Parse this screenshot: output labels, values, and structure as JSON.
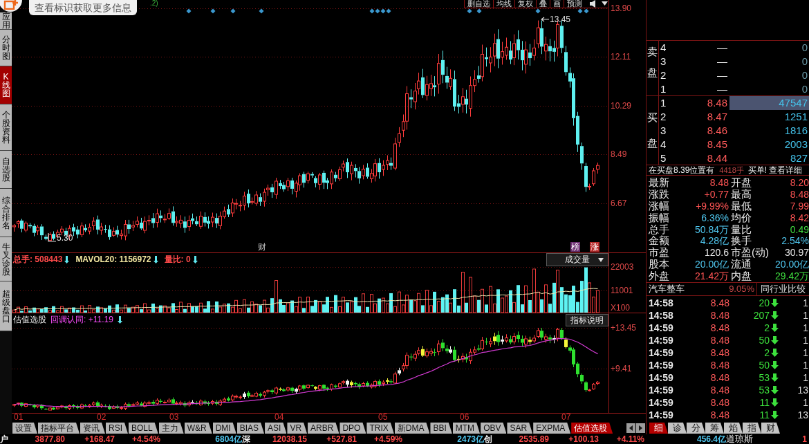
{
  "sidebar": {
    "tabs": [
      {
        "label": "应用",
        "selected": false
      },
      {
        "label": "分时图",
        "selected": false
      },
      {
        "label": "K线图",
        "selected": true
      },
      {
        "label": "个股资料",
        "selected": false
      },
      {
        "label": "自选股",
        "selected": false
      },
      {
        "label": "综合排名",
        "selected": false
      },
      {
        "label": "牛叉诊股",
        "selected": false
      },
      {
        "label": "超级盘口",
        "selected": false
      }
    ]
  },
  "tooltip": {
    "text": "查看标识获取更多信息"
  },
  "price_chart": {
    "title_fragment": ".2)",
    "toolbar": [
      "删自选",
      "均线",
      "复权",
      "叠",
      "画",
      "预测"
    ],
    "axis": [
      "13.90",
      "12.11",
      "10.29",
      "8.49",
      "6.67"
    ],
    "annotations": [
      {
        "kind": "high",
        "text": "13.45"
      },
      {
        "kind": "low",
        "text": "5.30"
      }
    ],
    "events": [
      {
        "text": "财",
        "kind": "plain"
      },
      {
        "text": "榜",
        "kind": "tag",
        "color": "#6e2f72"
      },
      {
        "text": "涨",
        "kind": "tag",
        "color": "#b82a2a"
      }
    ]
  },
  "volume_panel": {
    "stats": [
      {
        "text": "总手: 508443",
        "color": "#ff4a4a"
      },
      {
        "text": "MAVOL20: 1156972",
        "color": "#f2e6a0"
      },
      {
        "text": "量比: 0",
        "color": "#ff4a4a"
      }
    ],
    "selector": "成交量",
    "axis": [
      "22003",
      "11001",
      "X100"
    ]
  },
  "indicator_panel": {
    "name": "估值选股",
    "reading": "回调认同: +11.19",
    "help_button": "指标说明",
    "axis": [
      "+13.45",
      "+9.41"
    ]
  },
  "time_axis": [
    "01",
    "02",
    "03",
    "04",
    "05",
    "06",
    "07"
  ],
  "indicator_tabs": [
    {
      "label": "设置",
      "selected": false
    },
    {
      "label": "指标平台",
      "selected": false
    },
    {
      "label": "资讯",
      "selected": false
    },
    {
      "label": "RSI",
      "selected": false
    },
    {
      "label": "BOLL",
      "selected": false
    },
    {
      "label": "主力",
      "selected": false
    },
    {
      "label": "W&R",
      "selected": false
    },
    {
      "label": "DMI",
      "selected": false
    },
    {
      "label": "BIAS",
      "selected": false
    },
    {
      "label": "ASI",
      "selected": false
    },
    {
      "label": "VR",
      "selected": false
    },
    {
      "label": "ARBR",
      "selected": false
    },
    {
      "label": "DPO",
      "selected": false
    },
    {
      "label": "TRIX",
      "selected": false
    },
    {
      "label": "新DMA",
      "selected": false
    },
    {
      "label": "BBI",
      "selected": false
    },
    {
      "label": "MTM",
      "selected": false
    },
    {
      "label": "OBV",
      "selected": false
    },
    {
      "label": "SAR",
      "selected": false
    },
    {
      "label": "EXPMA",
      "selected": false
    },
    {
      "label": "估值选股",
      "selected": true
    }
  ],
  "order_book": {
    "sell_label": "卖盘",
    "buy_label": "买盘",
    "sell": [
      {
        "rank": "4",
        "price": "—",
        "volume": "0",
        "highlighted": false
      },
      {
        "rank": "3",
        "price": "—",
        "volume": "0",
        "highlighted": false
      },
      {
        "rank": "2",
        "price": "—",
        "volume": "0",
        "highlighted": false
      },
      {
        "rank": "1",
        "price": "—",
        "volume": "0",
        "highlighted": false
      }
    ],
    "buy": [
      {
        "rank": "1",
        "price": "8.48",
        "volume": "47547",
        "highlighted": true
      },
      {
        "rank": "2",
        "price": "8.47",
        "volume": "1251",
        "highlighted": false
      },
      {
        "rank": "3",
        "price": "8.46",
        "volume": "1816",
        "highlighted": false
      },
      {
        "rank": "4",
        "price": "8.45",
        "volume": "2003",
        "highlighted": false
      },
      {
        "rank": "5",
        "price": "8.44",
        "volume": "827",
        "highlighted": false
      }
    ]
  },
  "order_notice": {
    "text": "在买盘8.39位置有",
    "amount": "4418手",
    "tail": "买单!",
    "link": "查看详细"
  },
  "quote": [
    {
      "label": "最新",
      "value": "8.48",
      "color": "#ff5454"
    },
    {
      "label": "开盘",
      "value": "8.20",
      "color": "#ff5454"
    },
    {
      "label": "涨跌",
      "value": "+0.77",
      "color": "#ff5454"
    },
    {
      "label": "最高",
      "value": "8.48",
      "color": "#ff5454"
    },
    {
      "label": "涨幅",
      "value": "+9.99%",
      "color": "#ff5454"
    },
    {
      "label": "最低",
      "value": "7.99",
      "color": "#ff5454"
    },
    {
      "label": "振幅",
      "value": "6.36%",
      "color": "#4fc6ee"
    },
    {
      "label": "均价",
      "value": "8.42",
      "color": "#ff5454"
    },
    {
      "label": "总手",
      "value": "50.84万",
      "color": "#4fc6ee"
    },
    {
      "label": "量比",
      "value": "0.49",
      "color": "#3fdc3f"
    },
    {
      "label": "金额",
      "value": "4.28亿",
      "color": "#4fc6ee"
    },
    {
      "label": "换手",
      "value": "2.54%",
      "color": "#4fc6ee"
    },
    {
      "label": "市盈",
      "value": "120.6",
      "color": "#e6e6e6"
    },
    {
      "label": "市盈(动)",
      "value": "30.97",
      "color": "#e6e6e6"
    },
    {
      "label": "股本",
      "value": "20.00亿",
      "color": "#4fc6ee"
    },
    {
      "label": "流通",
      "value": "20.00亿",
      "color": "#4fc6ee"
    },
    {
      "label": "外盘",
      "value": "21.42万",
      "color": "#ff5454"
    },
    {
      "label": "内盘",
      "value": "29.42万",
      "color": "#3fdc3f"
    }
  ],
  "industry": {
    "name": "汽车整车",
    "change": "9.05%",
    "button": "同行业比较"
  },
  "ticks": [
    {
      "time": "14:58",
      "price": "8.48",
      "volume": "20",
      "column_4": "1"
    },
    {
      "time": "14:58",
      "price": "8.48",
      "volume": "207",
      "column_4": "1"
    },
    {
      "time": "14:59",
      "price": "8.48",
      "volume": "2",
      "column_4": "1"
    },
    {
      "time": "14:59",
      "price": "8.48",
      "volume": "50",
      "column_4": "1"
    },
    {
      "time": "14:59",
      "price": "8.48",
      "volume": "2",
      "column_4": "1"
    },
    {
      "time": "14:59",
      "price": "8.48",
      "volume": "50",
      "column_4": "1"
    },
    {
      "time": "14:59",
      "price": "8.48",
      "volume": "53",
      "column_4": "1"
    },
    {
      "time": "14:59",
      "price": "8.48",
      "volume": "53",
      "column_4": "13"
    },
    {
      "time": "14:59",
      "price": "8.48",
      "volume": "11",
      "column_4": "1"
    },
    {
      "time": "14:59",
      "price": "8.48",
      "volume": "11",
      "column_4": "13"
    }
  ],
  "panel_tabs": [
    {
      "label": "细",
      "selected": true
    },
    {
      "label": "诊",
      "selected": false
    },
    {
      "label": "分",
      "selected": false
    },
    {
      "label": "筹",
      "selected": false
    },
    {
      "label": "焰",
      "selected": false
    },
    {
      "label": "指",
      "selected": false
    },
    {
      "label": "财",
      "selected": false
    }
  ],
  "ticker": [
    {
      "name": "户",
      "index": "3877.80",
      "change": "+168.47",
      "percent": "+4.54%",
      "turnover": "6804亿"
    },
    {
      "name": "深",
      "index": "12038.15",
      "change": "+527.81",
      "percent": "+4.59%",
      "turnover": "2473亿"
    },
    {
      "name": "创",
      "index": "2535.89",
      "change": "+100.13",
      "percent": "+4.11%",
      "turnover": "456.4亿"
    },
    {
      "name": "道琼斯",
      "index": "1"
    }
  ]
}
